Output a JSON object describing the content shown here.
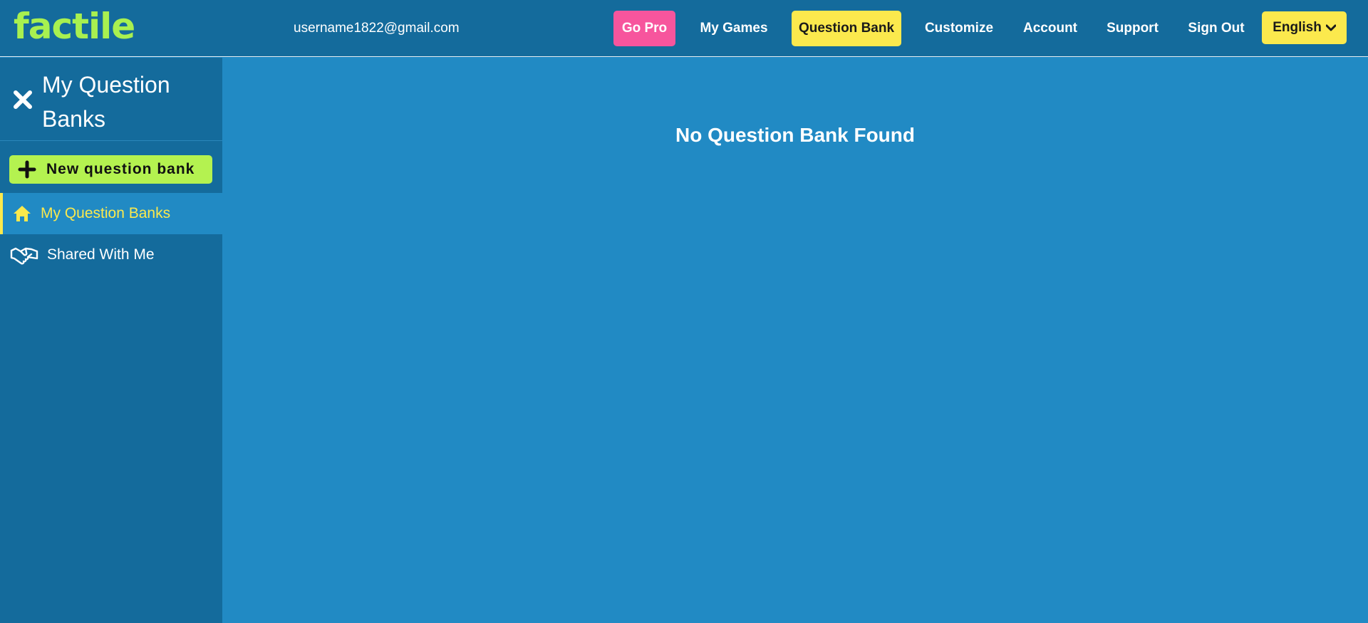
{
  "header": {
    "logo": "factile",
    "user_email": "username1822@gmail.com",
    "nav": {
      "go_pro": "Go Pro",
      "my_games": "My Games",
      "question_bank": "Question Bank",
      "customize": "Customize",
      "account": "Account",
      "support": "Support",
      "sign_out": "Sign Out",
      "language": "English"
    }
  },
  "sidebar": {
    "title": "My Question Banks",
    "new_button": "New question bank",
    "items": [
      {
        "label": "My Question Banks",
        "icon": "home-icon",
        "active": true
      },
      {
        "label": "Shared With Me",
        "icon": "handshake-icon",
        "active": false
      }
    ]
  },
  "main": {
    "empty_message": "No Question Bank Found"
  },
  "colors": {
    "header_bg": "#146b9c",
    "main_bg": "#218ac4",
    "logo_green": "#a8f050",
    "accent_yellow": "#fbe94d",
    "go_pro_pink": "#f7559d",
    "new_button_green": "#b4f250"
  }
}
